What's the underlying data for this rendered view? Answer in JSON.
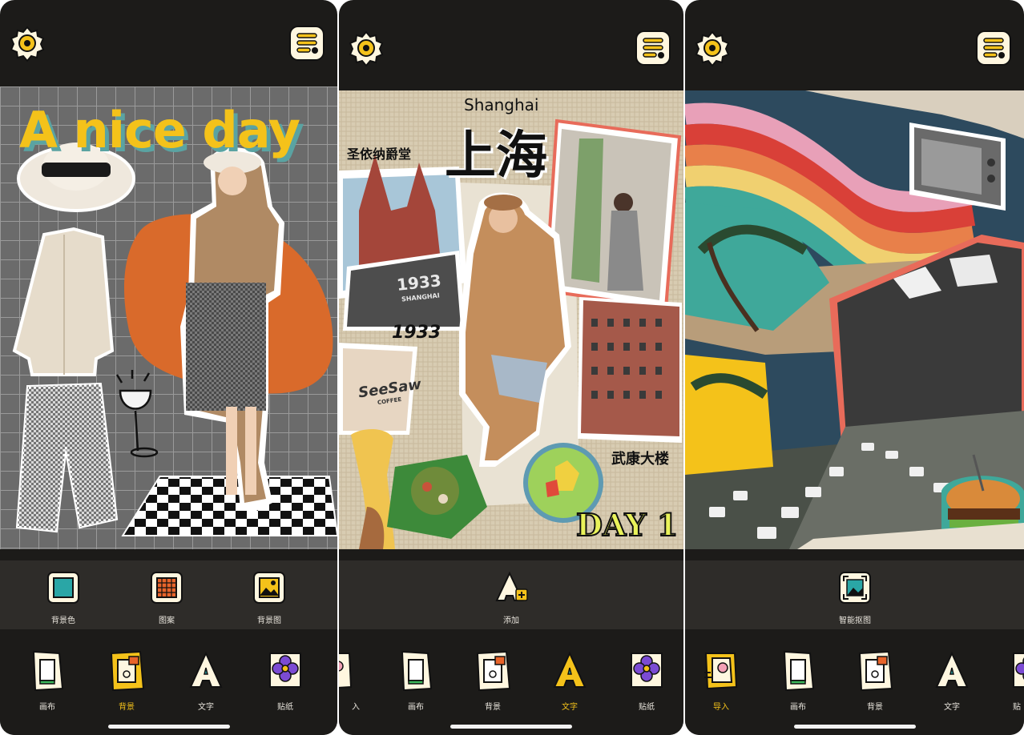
{
  "panels": [
    {
      "canvas_title": "A nice day",
      "tools": [
        "背景色",
        "图案",
        "背景图"
      ],
      "tabs": [
        "画布",
        "背景",
        "文字",
        "贴纸"
      ],
      "active_tab": "背景"
    },
    {
      "canvas_texts": {
        "city_en": "Shanghai",
        "city_cn": "上海",
        "church": "圣依纳爵堂",
        "sign": "1933",
        "sign_sub": "SHANGHAI",
        "year": "1933",
        "cup": "SeeSaw",
        "cup_sub": "COFFEE",
        "building": "武康大楼",
        "day": "DAY 1"
      },
      "tools": [
        "添加"
      ],
      "tabs": [
        "入",
        "画布",
        "背景",
        "文字",
        "贴纸"
      ],
      "active_tab": "文字"
    },
    {
      "tools": [
        "智能抠图"
      ],
      "tabs": [
        "导入",
        "画布",
        "背景",
        "文字",
        "贴"
      ],
      "active_tab": "导入"
    }
  ],
  "icons": {
    "settings": "gear-icon",
    "menu": "list-menu-icon"
  },
  "colors": {
    "accent": "#f4c21a",
    "app_bg": "#1c1b19",
    "subbar_bg": "#2e2c29",
    "canvas1_bg": "#6b6b6b",
    "orange_blob": "#d96a2b"
  }
}
